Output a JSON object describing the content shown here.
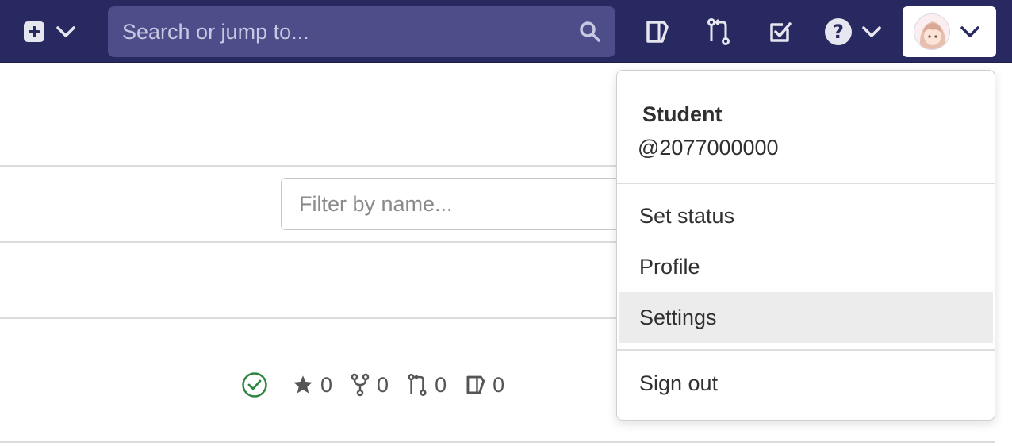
{
  "navbar": {
    "search_placeholder": "Search or jump to...",
    "colors": {
      "background": "#292961",
      "search_bg": "#4d4d8a"
    },
    "icons": [
      "plus-square-icon",
      "chevron-down-icon",
      "search-icon",
      "issues-icon",
      "merge-request-icon",
      "todo-icon",
      "help-icon",
      "avatar"
    ]
  },
  "page": {
    "filter_placeholder": "Filter by name...",
    "project_stats": {
      "stars": "0",
      "forks": "0",
      "merge_requests": "0",
      "issues": "0"
    }
  },
  "user_menu": {
    "name": "Student",
    "handle": "@2077000000",
    "items": [
      {
        "label": "Set status"
      },
      {
        "label": "Profile"
      },
      {
        "label": "Settings",
        "highlighted": true
      }
    ],
    "sign_out": "Sign out"
  }
}
